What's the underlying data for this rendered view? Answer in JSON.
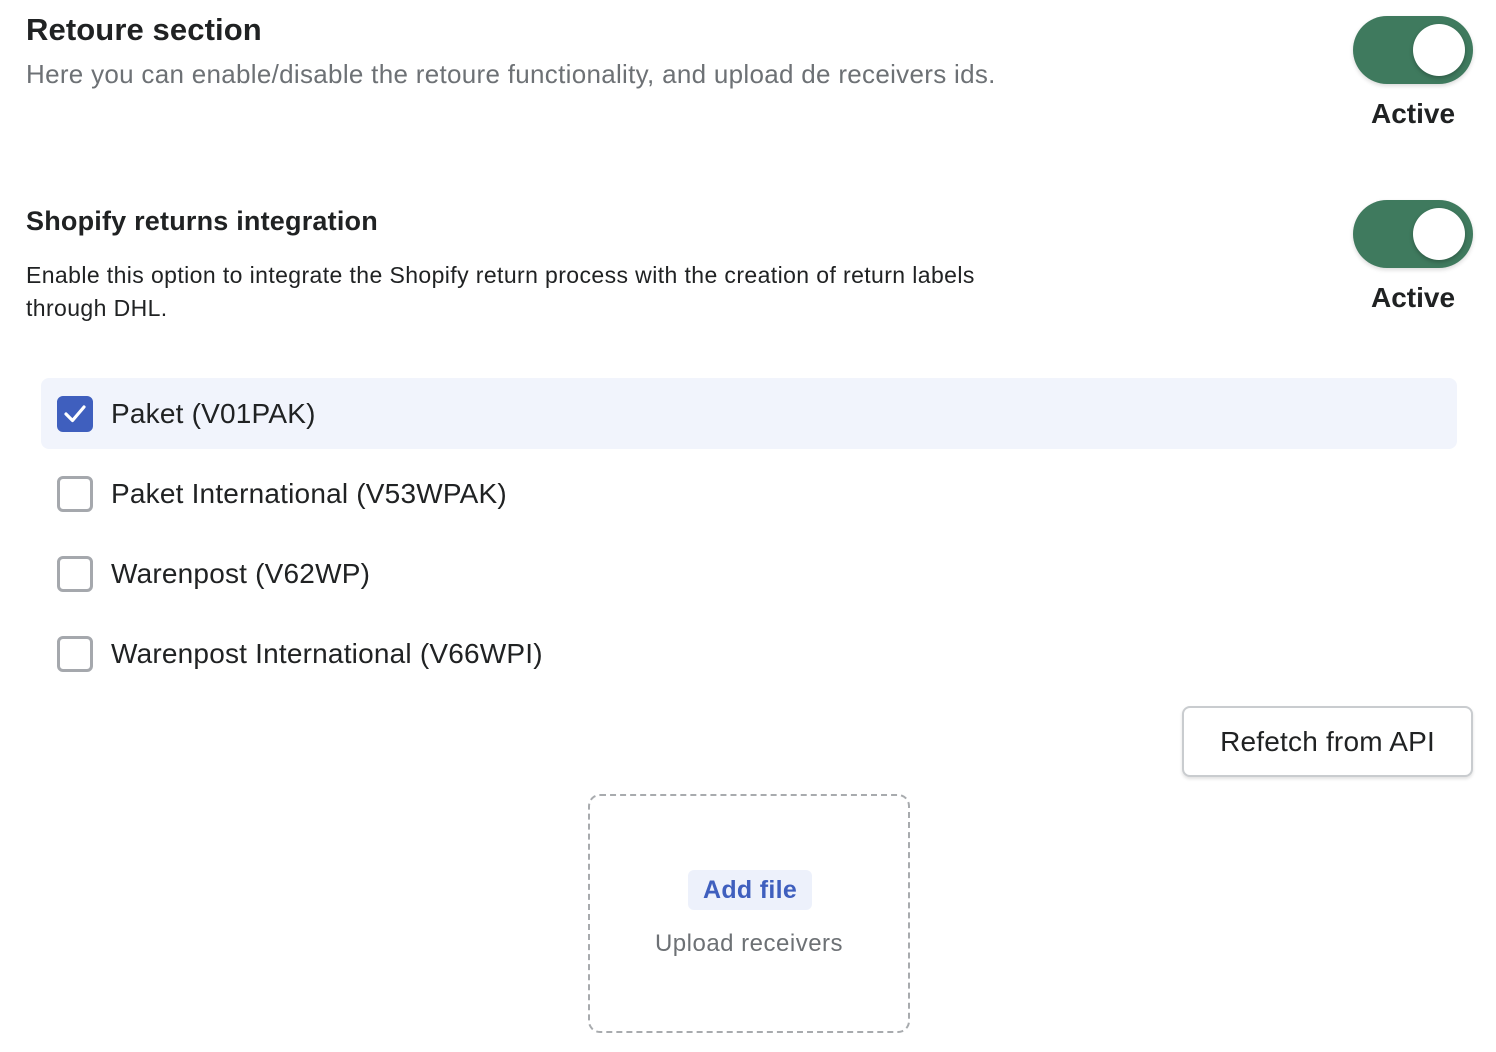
{
  "retoure": {
    "title": "Retoure section",
    "description": "Here you can enable/disable the retoure functionality, and upload de receivers ids.",
    "toggle_on": true,
    "status_label": "Active"
  },
  "shopify": {
    "title": "Shopify returns integration",
    "description": "Enable this option to integrate the Shopify return process with the creation of return labels through DHL.",
    "toggle_on": true,
    "status_label": "Active"
  },
  "options": [
    {
      "label": "Paket (V01PAK)",
      "checked": true
    },
    {
      "label": "Paket International (V53WPAK)",
      "checked": false
    },
    {
      "label": "Warenpost (V62WP)",
      "checked": false
    },
    {
      "label": "Warenpost International (V66WPI)",
      "checked": false
    }
  ],
  "refetch_label": "Refetch from API",
  "dropzone": {
    "add_file_label": "Add file",
    "hint": "Upload receivers"
  },
  "colors": {
    "toggle_on": "#3f7a5e",
    "accent": "#3f5fbe",
    "selected_row": "#f1f4fc"
  },
  "icons": {
    "checkbox_checked": "checkmark-icon"
  }
}
